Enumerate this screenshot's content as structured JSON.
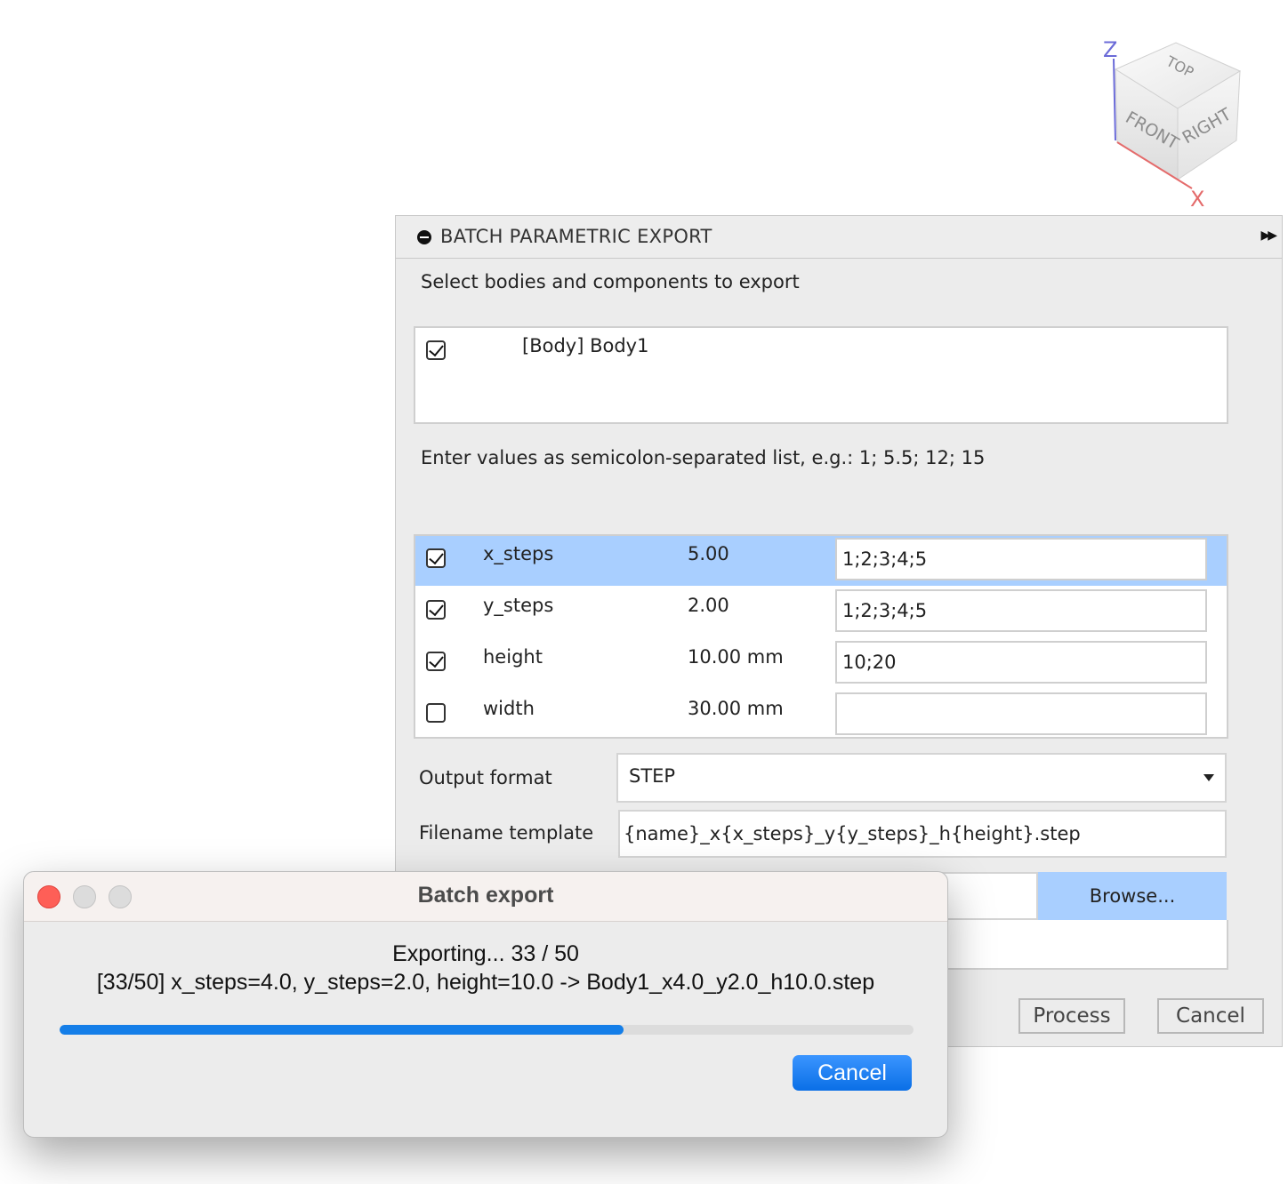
{
  "viewcube": {
    "axis_z": "Z",
    "axis_x": "X",
    "face_top": "TOP",
    "face_front": "FRONT",
    "face_right": "RIGHT"
  },
  "panel": {
    "title": "BATCH PARAMETRIC EXPORT",
    "expand_icon": "double-chevron-right-icon",
    "bodies_label": "Select bodies and components to export",
    "bodies": [
      {
        "label": "[Body] Body1",
        "checked": true
      }
    ],
    "hint": "Enter values as semicolon-separated list, e.g.: 1; 5.5; 12; 15",
    "parameters": [
      {
        "name": "x_steps",
        "value": "5.00",
        "list": "1;2;3;4;5",
        "checked": true,
        "selected": true
      },
      {
        "name": "y_steps",
        "value": "2.00",
        "list": "1;2;3;4;5",
        "checked": true,
        "selected": false
      },
      {
        "name": "height",
        "value": "10.00 mm",
        "list": "10;20",
        "checked": true,
        "selected": false
      },
      {
        "name": "width",
        "value": "30.00 mm",
        "list": "",
        "checked": false,
        "selected": false
      }
    ],
    "output_format_label": "Output format",
    "output_format_value": "STEP",
    "filename_label": "Filename template",
    "filename_value": "{name}_x{x_steps}_y{y_steps}_h{height}.step",
    "browse_label": "Browse...",
    "process_label": "Process",
    "cancel_label": "Cancel"
  },
  "dialog": {
    "title": "Batch export",
    "status": "Exporting... 33 / 50",
    "detail": "[33/50] x_steps=4.0, y_steps=2.0, height=10.0 -> Body1_x4.0_y2.0_h10.0.step",
    "progress_done": 33,
    "progress_total": 50,
    "cancel_label": "Cancel",
    "accent_color": "#147ee8",
    "close_color": "#fe5f57"
  }
}
